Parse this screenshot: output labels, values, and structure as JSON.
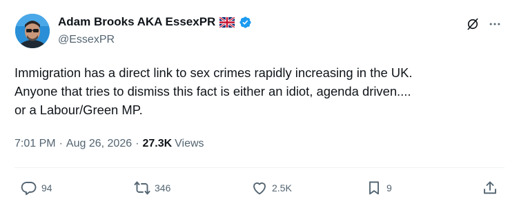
{
  "author": {
    "display_name": "Adam Brooks AKA EssexPR",
    "handle": "@EssexPR",
    "verified": true,
    "flag": "uk-flag-emoji",
    "accent_color": "#1d9bf0"
  },
  "post": {
    "text_lines": [
      "Immigration has a direct link to sex crimes rapidly increasing in the UK.",
      "Anyone that tries to dismiss this fact is either an idiot, agenda driven....",
      "or a Labour/Green MP."
    ],
    "time": "7:01 PM",
    "date": "Aug 26, 2026",
    "separator": "·",
    "views_count": "27.3K",
    "views_label": "Views"
  },
  "actions": {
    "replies": "94",
    "reposts": "346",
    "likes": "2.5K",
    "bookmarks": "9"
  },
  "icons": {
    "header_right": [
      "grok-icon",
      "more-icon"
    ],
    "action_bar": [
      "reply-icon",
      "repost-icon",
      "like-icon",
      "bookmark-icon",
      "share-icon"
    ]
  },
  "colors": {
    "text_primary": "#0f1419",
    "text_secondary": "#536471",
    "verified_blue": "#1d9bf0",
    "divider": "#eff3f4"
  }
}
